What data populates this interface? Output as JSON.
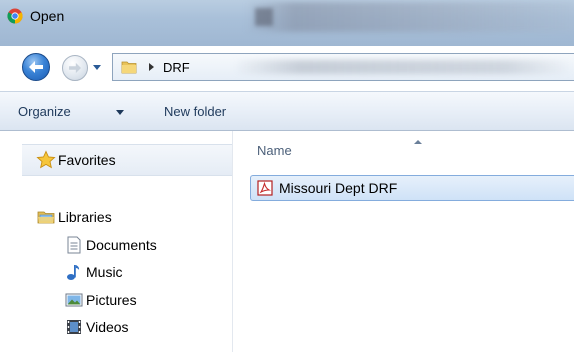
{
  "window": {
    "title": "Open",
    "app_icon": "chrome-icon"
  },
  "address_bar": {
    "path": [
      "DRF"
    ],
    "folder_icon": "folder-icon"
  },
  "toolbar": {
    "organize_label": "Organize",
    "new_folder_label": "New folder"
  },
  "nav_pane": {
    "favorites": {
      "label": "Favorites",
      "icon": "star-icon"
    },
    "libraries": {
      "label": "Libraries",
      "icon": "libraries-icon",
      "items": [
        {
          "label": "Documents",
          "icon": "documents-icon"
        },
        {
          "label": "Music",
          "icon": "music-icon"
        },
        {
          "label": "Pictures",
          "icon": "pictures-icon"
        },
        {
          "label": "Videos",
          "icon": "videos-icon"
        }
      ]
    }
  },
  "file_list": {
    "columns": [
      "Name"
    ],
    "sort": "ascending",
    "files": [
      {
        "name": "Missouri Dept DRF",
        "icon": "pdf-icon",
        "selected": true
      }
    ]
  },
  "colors": {
    "titlebar": "#a9c0d9",
    "toolbar_text": "#1e395b",
    "selection": "#cfe2f7",
    "selection_border": "#84acdd"
  }
}
